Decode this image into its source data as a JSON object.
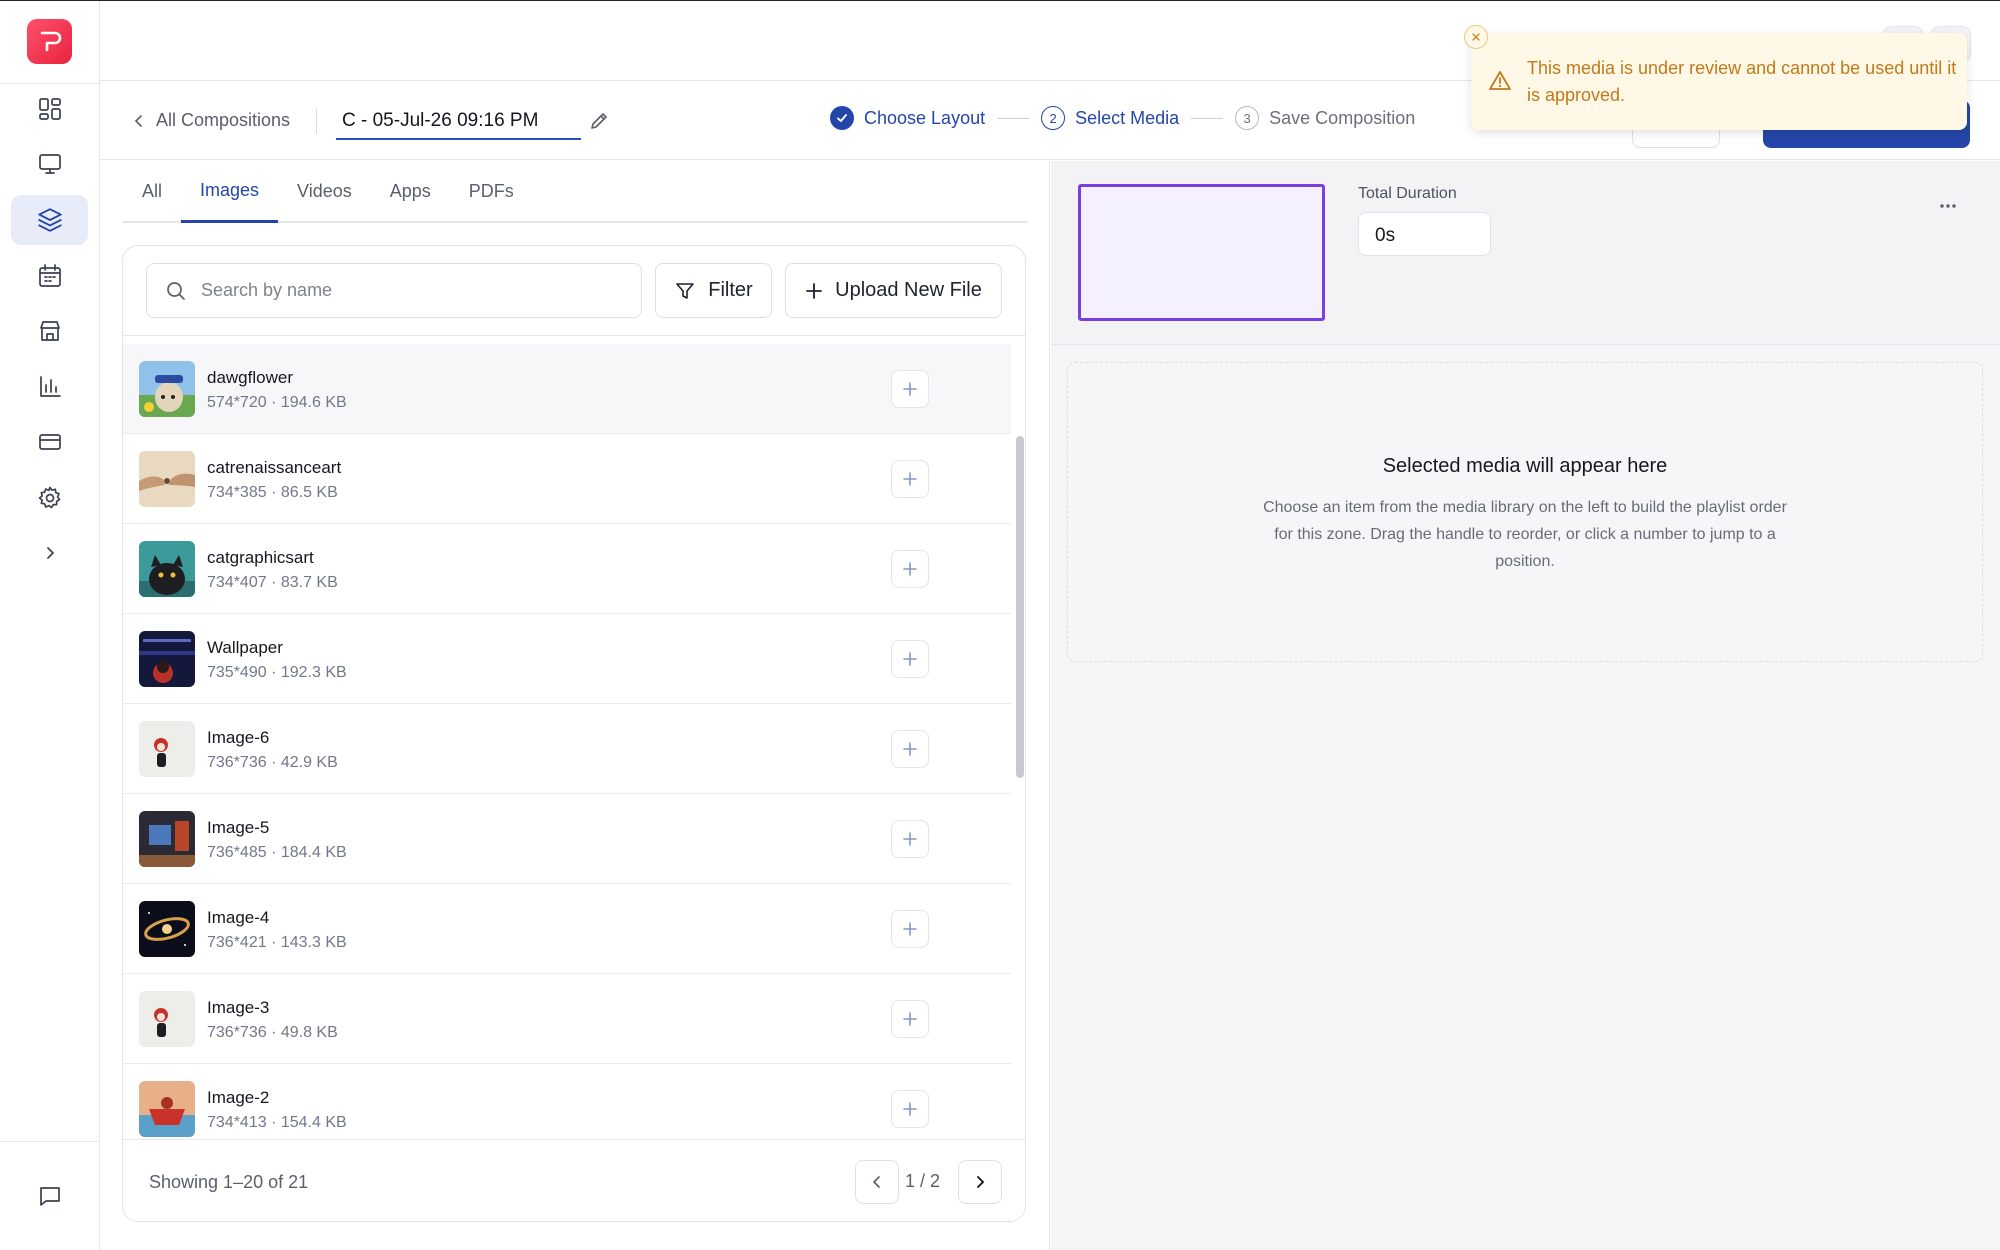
{
  "nav": {
    "items": [
      {
        "name": "dashboard",
        "icon": "dashboard-icon"
      },
      {
        "name": "screens",
        "icon": "monitor-icon"
      },
      {
        "name": "compositions",
        "icon": "layers-icon",
        "active": true
      },
      {
        "name": "schedule",
        "icon": "calendar-icon"
      },
      {
        "name": "store",
        "icon": "store-icon"
      },
      {
        "name": "reports",
        "icon": "bar-chart-icon"
      },
      {
        "name": "billing",
        "icon": "credit-card-icon"
      },
      {
        "name": "settings",
        "icon": "gear-icon"
      },
      {
        "name": "expand",
        "icon": "chevron-right-icon"
      }
    ],
    "bottom_icon": "chat-icon"
  },
  "header": {
    "back_label": "All Compositions",
    "composition_title": "C - 05-Jul-26 09:16 PM",
    "steps": [
      {
        "number": "1",
        "label": "Choose Layout",
        "state": "done"
      },
      {
        "number": "2",
        "label": "Select Media",
        "state": "current"
      },
      {
        "number": "3",
        "label": "Save Composition",
        "state": "pending"
      }
    ]
  },
  "tabs": [
    "All",
    "Images",
    "Videos",
    "Apps",
    "PDFs"
  ],
  "active_tab": "Images",
  "search": {
    "placeholder": "Search by name",
    "value": ""
  },
  "toolbar": {
    "filter_label": "Filter",
    "upload_label": "Upload New File"
  },
  "media": [
    {
      "name": "dawgflower",
      "meta": "574*720 · 194.6 KB"
    },
    {
      "name": "catrenaissanceart",
      "meta": "734*385 · 86.5 KB"
    },
    {
      "name": "catgraphicsart",
      "meta": "734*407 · 83.7 KB"
    },
    {
      "name": "Wallpaper",
      "meta": "735*490 · 192.3 KB"
    },
    {
      "name": "Image-6",
      "meta": "736*736 · 42.9 KB"
    },
    {
      "name": "Image-5",
      "meta": "736*485 · 184.4 KB"
    },
    {
      "name": "Image-4",
      "meta": "736*421 · 143.3 KB"
    },
    {
      "name": "Image-3",
      "meta": "736*736 · 49.8 KB"
    },
    {
      "name": "Image-2",
      "meta": "734*413 · 154.4 KB"
    }
  ],
  "footer": {
    "showing": "Showing 1–20 of 21",
    "page": "1 / 2"
  },
  "zone": {
    "duration_label": "Total Duration",
    "duration_value": "0s",
    "empty_title": "Selected media will appear here",
    "empty_desc": "Choose an item from the media library on the left to build the playlist order for this zone. Drag the handle to reorder, or click a number to jump to a position."
  },
  "toast": {
    "message": "This media is under review and cannot be used until it is approved."
  },
  "colors": {
    "accent": "#2446a8",
    "zone_border": "#7b3fe0",
    "warning_text": "#c07a1a",
    "warning_bg": "#fff8e6",
    "logo": "#e8243f"
  }
}
